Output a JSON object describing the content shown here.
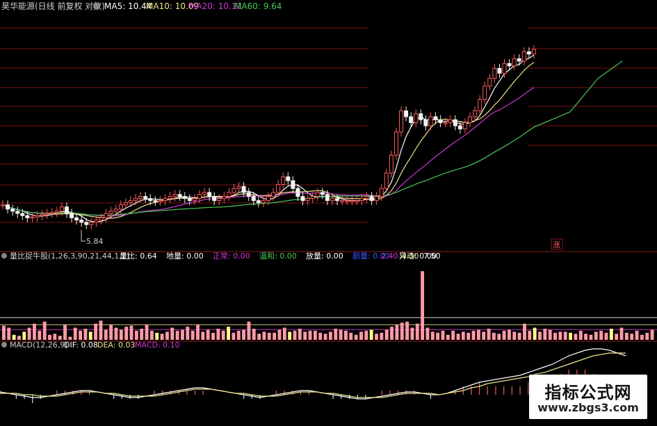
{
  "colors": {
    "background": "#000000",
    "grid": "#7a1515",
    "candle_up": "#ff5b5b",
    "candle_down": "#f2f2f2",
    "ma5": "#ffffff",
    "ma10": "#f0e68c",
    "ma20": "#d236d2",
    "ma60": "#49c95b",
    "vol_bar": "#ff9aa8",
    "vol_bar_yellow": "#ffff88",
    "macd_pos": "#ff5b5b",
    "macd_neg": "#cfd8ff",
    "label_gray": "#cfcfcf"
  },
  "top_panel": {
    "title_prefix": "昊华能源(日线 前复权 对数)",
    "gear_icon": "gear-icon",
    "ma5_label": "MA5: 10.44",
    "ma10_label": "MA10: 10.09",
    "ma20_label": "MA20: 10.12",
    "ma60_label": "MA60: 9.64",
    "low_marker": "5.84",
    "corner_tag": "涨"
  },
  "mid_panel": {
    "name": "量比捉牛股(1,26,3,90,21,44,1,1)",
    "items": [
      {
        "label": "量比:",
        "value": "0.64",
        "color": "#ffffff"
      },
      {
        "label": "地量:",
        "value": "0.00",
        "color": "#ffffff"
      },
      {
        "label": "正常:",
        "value": "0.00",
        "color": "#d236d2"
      },
      {
        "label": "温和:",
        "value": "0.00",
        "color": "#49c95b"
      },
      {
        "label": "放量:",
        "value": "0.00",
        "color": "#ffffff"
      },
      {
        "label": "剧量:",
        "value": "0.00",
        "color": "#3355ff"
      },
      {
        "label": "异动:",
        "value": "0.00",
        "color": "#ffffff"
      }
    ],
    "levels": [
      "2.40",
      "4.50",
      "7.50"
    ]
  },
  "bottom_panel": {
    "name": "MACD(12,26,9)",
    "dif_label": "DIF: 0.08",
    "dea_label": "DEA: 0.03",
    "macd_label": "MACD: 0.10"
  },
  "watermark": {
    "title": "指标公式网",
    "url": "www.zbgs3.com"
  },
  "chart_data": [
    {
      "type": "candlestick",
      "title": "昊华能源(日线 前复权 对数)",
      "series_labels": [
        "MA5: 10.44",
        "MA10: 10.09",
        "MA20: 10.12",
        "MA60: 9.64"
      ],
      "annotation": "5.84",
      "closes": [
        5.9,
        5.8,
        5.75,
        5.7,
        5.65,
        5.6,
        5.62,
        5.65,
        5.68,
        5.7,
        5.72,
        5.75,
        5.85,
        5.7,
        5.6,
        5.55,
        5.5,
        5.45,
        5.5,
        5.55,
        5.6,
        5.7,
        5.75,
        5.8,
        5.9,
        5.95,
        6.0,
        6.05,
        6.1,
        6.05,
        6.0,
        5.98,
        6.0,
        6.05,
        6.1,
        6.15,
        6.1,
        6.05,
        6.0,
        6.05,
        6.15,
        6.2,
        6.1,
        6.0,
        6.05,
        6.1,
        6.2,
        6.3,
        6.35,
        6.2,
        6.1,
        6.0,
        5.95,
        6.0,
        6.1,
        6.2,
        6.4,
        6.6,
        6.5,
        6.3,
        6.1,
        6.0,
        6.05,
        6.1,
        6.2,
        6.15,
        6.0,
        6.05,
        6.0,
        6.0,
        6.0,
        6.0,
        6.0,
        6.05,
        6.1,
        6.0,
        6.1,
        6.3,
        6.7,
        7.2,
        7.9,
        8.6,
        8.4,
        8.2,
        8.5,
        8.3,
        8.1,
        8.4,
        8.3,
        8.2,
        8.2,
        8.3,
        8.1,
        8.0,
        8.2,
        8.4,
        8.6,
        9.0,
        9.5,
        9.8,
        10.2,
        10.0,
        10.4,
        10.3,
        10.6,
        10.5,
        10.9,
        10.8,
        11.0
      ]
    },
    {
      "type": "bar",
      "title": "量比捉牛股(1,26,3,90,21,44,1,1)",
      "series_labels": [
        "量比: 0.64",
        "地量: 0.00",
        "正常: 0.00",
        "温和: 0.00",
        "放量: 0.00",
        "剧量: 0.00",
        "异动: 0.00"
      ],
      "reference_levels": [
        2.4,
        4.5,
        7.5
      ],
      "values": [
        1.4,
        1.2,
        0.5,
        0.4,
        0.8,
        1.2,
        1.6,
        0.9,
        1.8,
        0.5,
        0.6,
        0.4,
        1.5,
        0.3,
        1.2,
        0.9,
        1.1,
        0.8,
        1.6,
        1.9,
        1.0,
        1.5,
        1.2,
        1.0,
        1.3,
        1.4,
        0.9,
        1.1,
        1.5,
        0.9,
        0.7,
        0.6,
        0.8,
        1.2,
        0.9,
        1.0,
        1.3,
        0.9,
        1.5,
        0.8,
        1.0,
        0.7,
        1.1,
        0.9,
        1.3,
        0.7,
        0.9,
        1.0,
        1.8,
        1.1,
        0.6,
        0.8,
        0.7,
        0.7,
        1.0,
        1.2,
        0.8,
        0.9,
        1.1,
        0.8,
        0.9,
        0.9,
        0.7,
        0.6,
        0.8,
        1.1,
        1.0,
        0.9,
        0.7,
        0.5,
        0.8,
        0.9,
        1.0,
        0.6,
        0.7,
        1.0,
        1.3,
        1.5,
        1.7,
        1.8,
        1.2,
        1.6,
        6.8,
        1.2,
        0.8,
        0.7,
        0.9,
        0.5,
        0.9,
        0.6,
        0.8,
        0.7,
        0.9,
        1.0,
        0.8,
        1.1,
        0.7,
        0.6,
        0.9,
        1.0,
        0.8,
        0.7,
        1.6,
        0.9,
        1.2,
        0.8,
        1.1,
        1.0,
        0.7,
        0.8,
        0.8,
        0.7,
        0.6,
        0.9,
        0.6,
        0.5,
        0.8,
        0.9,
        0.7,
        1.1,
        0.6,
        1.2,
        0.7,
        0.6,
        0.9,
        0.5,
        0.7,
        1.0
      ],
      "yellow_indices": [
        2,
        4,
        17,
        30,
        44,
        56,
        72,
        104,
        111,
        119
      ]
    },
    {
      "type": "line",
      "title": "MACD(12,26,9)",
      "series_labels": [
        "DIF: 0.08",
        "DEA: 0.03",
        "MACD: 0.10"
      ],
      "dif": [
        0.02,
        0.01,
        0.0,
        -0.01,
        -0.02,
        -0.02,
        -0.01,
        0.0,
        0.01,
        0.02,
        0.03,
        0.03,
        0.02,
        0.01,
        0.0,
        -0.01,
        -0.02,
        -0.02,
        -0.01,
        0.0,
        0.01,
        0.02,
        0.03,
        0.04,
        0.05,
        0.05,
        0.04,
        0.03,
        0.02,
        0.01,
        0.0,
        -0.01,
        -0.02,
        -0.01,
        0.0,
        0.01,
        0.02,
        0.03,
        0.03,
        0.02,
        0.01,
        0.0,
        -0.01,
        -0.02,
        -0.03,
        -0.03,
        -0.02,
        -0.01,
        0.0,
        0.01,
        0.02,
        0.02,
        0.01,
        0.0,
        0.0,
        0.01,
        0.03,
        0.05,
        0.07,
        0.09,
        0.1,
        0.11,
        0.12,
        0.13,
        0.14,
        0.16,
        0.18,
        0.2,
        0.22,
        0.25,
        0.28,
        0.3,
        0.32,
        0.33,
        0.33,
        0.32,
        0.3,
        0.28
      ],
      "dea": [
        0.01,
        0.01,
        0.01,
        0.0,
        0.0,
        -0.01,
        -0.01,
        -0.01,
        0.0,
        0.01,
        0.02,
        0.02,
        0.02,
        0.01,
        0.01,
        0.0,
        -0.01,
        -0.01,
        -0.01,
        -0.01,
        0.0,
        0.01,
        0.02,
        0.03,
        0.04,
        0.04,
        0.04,
        0.03,
        0.02,
        0.01,
        0.01,
        0.0,
        -0.01,
        -0.01,
        -0.01,
        0.0,
        0.01,
        0.02,
        0.02,
        0.02,
        0.01,
        0.01,
        0.0,
        -0.01,
        -0.02,
        -0.02,
        -0.02,
        -0.02,
        -0.01,
        0.0,
        0.01,
        0.01,
        0.01,
        0.01,
        0.0,
        0.01,
        0.02,
        0.03,
        0.05,
        0.06,
        0.08,
        0.09,
        0.1,
        0.11,
        0.12,
        0.13,
        0.15,
        0.16,
        0.18,
        0.2,
        0.22,
        0.24,
        0.26,
        0.28,
        0.29,
        0.3,
        0.3,
        0.3
      ],
      "histogram": [
        0.01,
        0.0,
        -0.01,
        -0.01,
        -0.02,
        -0.01,
        0.0,
        0.01,
        0.01,
        0.01,
        0.01,
        0.01,
        0.0,
        0.0,
        -0.01,
        -0.01,
        -0.01,
        -0.01,
        0.0,
        0.01,
        0.01,
        0.01,
        0.01,
        0.01,
        0.01,
        0.01,
        0.0,
        0.0,
        0.0,
        0.0,
        -0.01,
        -0.01,
        -0.01,
        0.0,
        0.01,
        0.01,
        0.01,
        0.01,
        0.01,
        0.0,
        0.0,
        -0.01,
        -0.01,
        -0.01,
        -0.01,
        -0.01,
        0.0,
        0.01,
        0.01,
        0.01,
        0.01,
        0.01,
        0.0,
        -0.01,
        0.0,
        0.0,
        0.01,
        0.02,
        0.02,
        0.03,
        0.02,
        0.02,
        0.02,
        0.02,
        0.02,
        0.03,
        0.03,
        0.04,
        0.04,
        0.05,
        0.06,
        0.06,
        0.06,
        0.05,
        0.04,
        0.02,
        0.0,
        -0.02
      ]
    }
  ]
}
